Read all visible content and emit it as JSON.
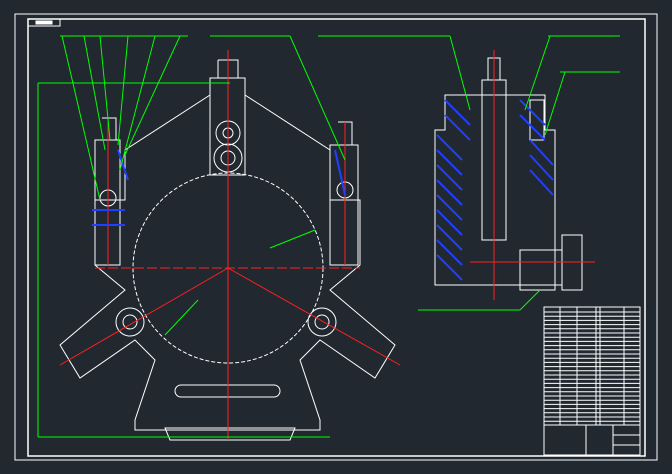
{
  "colors": {
    "background": "#212830",
    "outline": "#ffffff",
    "centerline": "#ff2020",
    "dimension": "#00ff00",
    "hatch": "#2040ff"
  }
}
